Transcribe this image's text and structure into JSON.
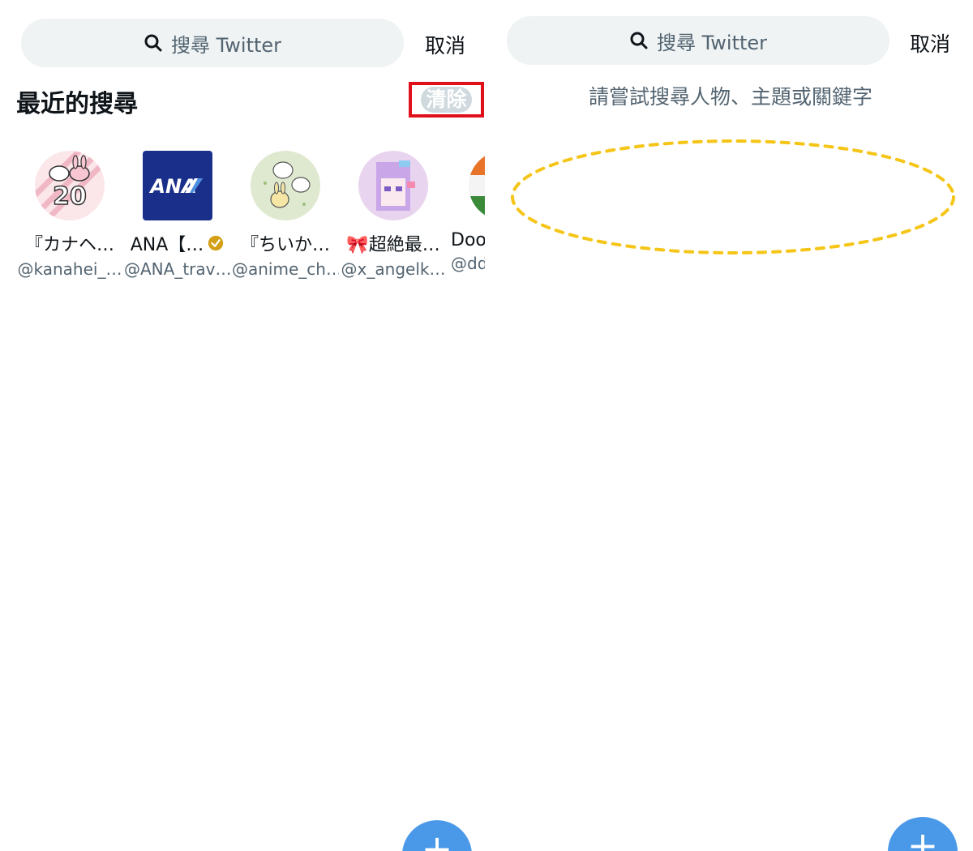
{
  "left": {
    "search": {
      "placeholder": "搜尋 Twitter"
    },
    "cancel_label": "取消",
    "recent_title": "最近的搜尋",
    "clear_label": "清除",
    "recent_items": [
      {
        "name": "『カナヘ…",
        "handle": "@kanahei_…",
        "avatar_icon": "kanahei-avatar-icon",
        "verified": false
      },
      {
        "name": "ANA【…",
        "handle": "@ANA_trav…",
        "avatar_icon": "ana-logo-icon",
        "avatar_text": "ANA",
        "verified": true
      },
      {
        "name": "『ちいか…",
        "handle": "@anime_ch…",
        "avatar_icon": "chiikawa-avatar-icon",
        "verified": false
      },
      {
        "name": "🎀超絶最…",
        "handle": "@x_angelk…",
        "avatar_icon": "angel-avatar-icon",
        "verified": false
      },
      {
        "name": "Doo",
        "handle": "@dd",
        "avatar_icon": "flag-avatar-icon",
        "verified": false
      }
    ],
    "fab_label": "+"
  },
  "right": {
    "search": {
      "placeholder": "搜尋 Twitter"
    },
    "cancel_label": "取消",
    "hint_text": "請嘗試搜尋人物、主題或關鍵字",
    "fab_label": "+"
  },
  "colors": {
    "search_bg": "#eff3f4",
    "highlight_box": "#e0101a",
    "highlight_ellipse": "#f5c518",
    "fab": "#4a99e9",
    "secondary_text": "#536471",
    "verified_gold": "#d4a017"
  }
}
